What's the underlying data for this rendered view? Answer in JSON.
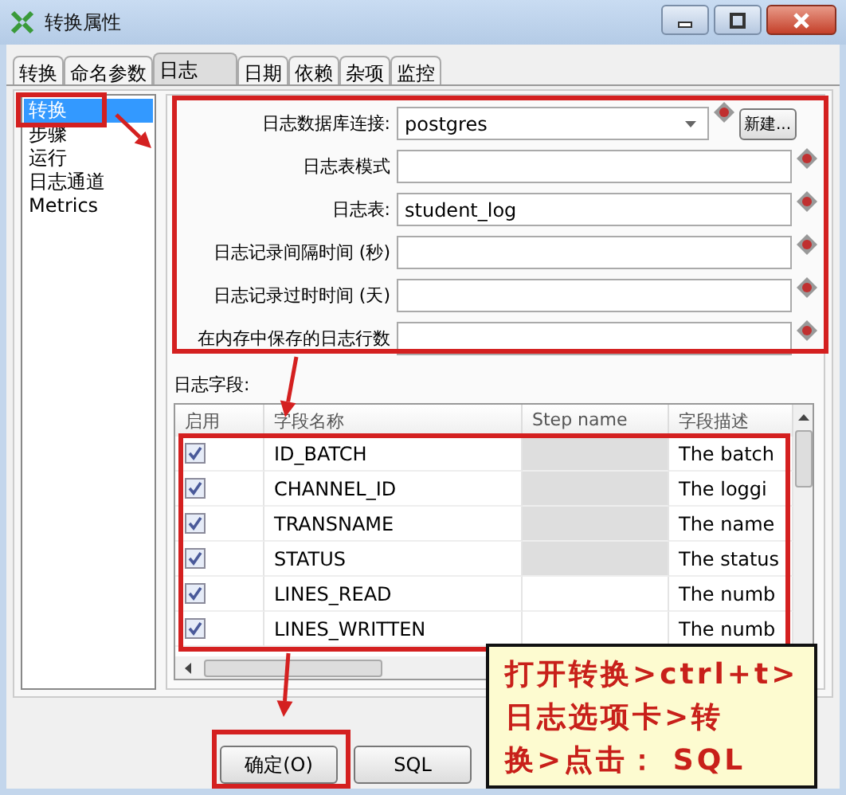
{
  "window": {
    "title": "转换属性"
  },
  "tabs": [
    {
      "label": "转换",
      "selected": false
    },
    {
      "label": "命名参数",
      "selected": false
    },
    {
      "label": "日志",
      "selected": true
    },
    {
      "label": "日期",
      "selected": false
    },
    {
      "label": "依赖",
      "selected": false
    },
    {
      "label": "杂项",
      "selected": false
    },
    {
      "label": "监控",
      "selected": false
    }
  ],
  "sidebar": {
    "items": [
      {
        "label": "转换",
        "selected": true
      },
      {
        "label": "步骤",
        "selected": false
      },
      {
        "label": "运行",
        "selected": false
      },
      {
        "label": "日志通道",
        "selected": false
      },
      {
        "label": "Metrics",
        "selected": false
      }
    ]
  },
  "log_settings": {
    "new_button": "新建...",
    "fields": [
      {
        "label": "日志数据库连接:",
        "kind": "dropdown",
        "value": "postgres"
      },
      {
        "label": "日志表模式",
        "kind": "text"
      },
      {
        "label": "日志表:",
        "kind": "text",
        "value": "student_log"
      },
      {
        "label": "日志记录间隔时间 (秒)",
        "kind": "text"
      },
      {
        "label": "日志记录过时时间 (天)",
        "kind": "text"
      },
      {
        "label": "在内存中保存的日志行数",
        "kind": "text"
      }
    ]
  },
  "log_fields": {
    "label": "日志字段:",
    "columns": [
      "启用",
      "字段名称",
      "Step name",
      "字段描述"
    ],
    "rows": [
      {
        "enabled": true,
        "name": "ID_BATCH",
        "step_name_disabled": true,
        "description": "The batch"
      },
      {
        "enabled": true,
        "name": "CHANNEL_ID",
        "step_name_disabled": true,
        "description": "The loggi"
      },
      {
        "enabled": true,
        "name": "TRANSNAME",
        "step_name_disabled": true,
        "description": "The name"
      },
      {
        "enabled": true,
        "name": "STATUS",
        "step_name_disabled": true,
        "description": "The status"
      },
      {
        "enabled": true,
        "name": "LINES_READ",
        "step_name_disabled": false,
        "description": "The numb"
      },
      {
        "enabled": true,
        "name": "LINES_WRITTEN",
        "step_name_disabled": false,
        "description": "The numb"
      }
    ]
  },
  "buttons": [
    {
      "label": "确定(O)"
    },
    {
      "label": "SQL"
    }
  ],
  "annotation": {
    "lines": [
      "打开转换>ctrl+t>",
      "日志选项卡>转",
      "换>点击： SQL"
    ]
  }
}
